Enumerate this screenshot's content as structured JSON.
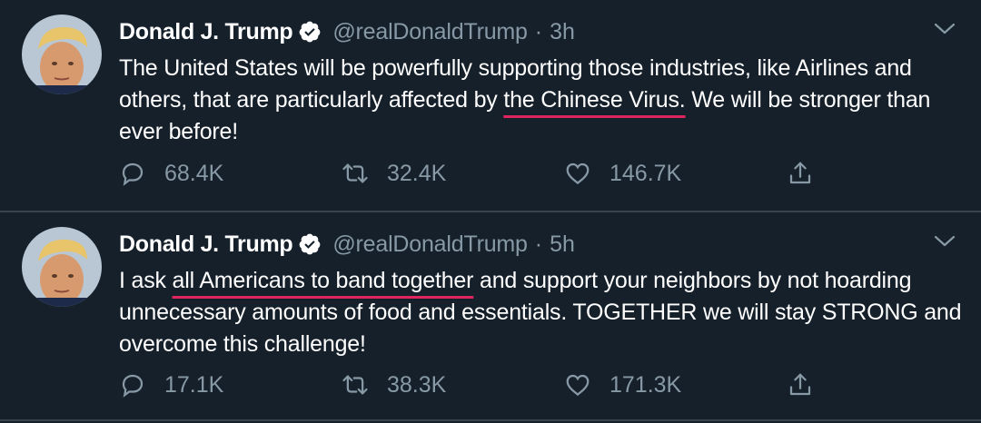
{
  "tweets": [
    {
      "name": "Donald J. Trump",
      "handle": "@realDonaldTrump",
      "separator": "·",
      "time": "3h",
      "text_before": "The United States will be powerfully supporting those industries, like Airlines and others, that are particularly affected by ",
      "text_highlight": "the Chinese Virus.",
      "text_after": " We will be stronger than ever before!",
      "replies": "68.4K",
      "retweets": "32.4K",
      "likes": "146.7K"
    },
    {
      "name": "Donald J. Trump",
      "handle": "@realDonaldTrump",
      "separator": "·",
      "time": "5h",
      "text_before": "I ask ",
      "text_highlight": "all Americans to band together",
      "text_after": " and support your neighbors by not hoarding unnecessary amounts of food and essentials. TOGETHER we will stay STRONG and overcome this challenge!",
      "replies": "17.1K",
      "retweets": "38.3K",
      "likes": "171.3K"
    }
  ],
  "colors": {
    "background": "#15202b",
    "muted": "#8899a6",
    "highlight_underline": "#e0245e",
    "divider": "#38444d"
  },
  "icons": [
    "avatar",
    "verified-badge-icon",
    "chevron-down-icon",
    "reply-icon",
    "retweet-icon",
    "like-icon",
    "share-icon"
  ]
}
